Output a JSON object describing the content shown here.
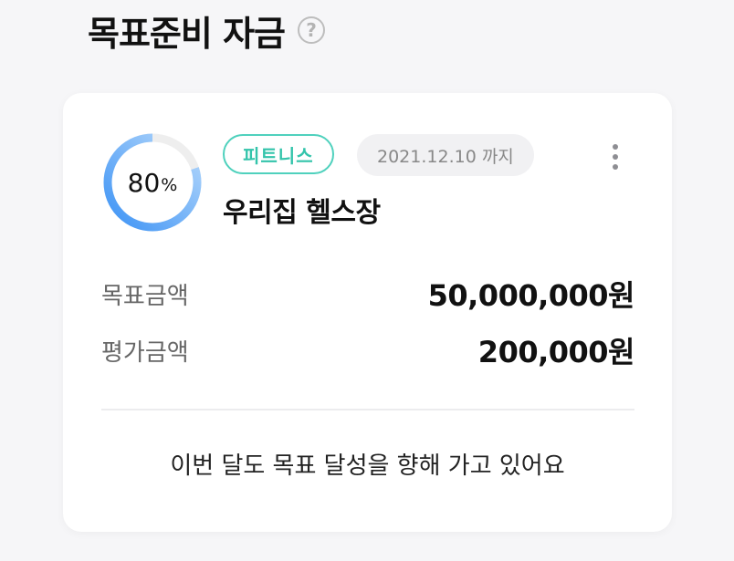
{
  "section": {
    "title": "목표준비 자금",
    "help_glyph": "?"
  },
  "goal_card": {
    "progress": {
      "value": "80",
      "unit": "%",
      "fraction": 0.8,
      "color_start": "#3d93f5",
      "color_end": "#b7d9fb",
      "track_color": "#eeeeee"
    },
    "category_tag": "피트니스",
    "due_date": "2021.12.10 까지",
    "goal_name": "우리집 헬스장",
    "more_icon": "more-vertical-icon",
    "rows": [
      {
        "label": "목표금액",
        "value": "50,000,000원"
      },
      {
        "label": "평가금액",
        "value": "200,000원"
      }
    ],
    "message": "이번 달도 목표 달성을 향해 가고 있어요"
  },
  "colors": {
    "tag_accent": "#33c4ab",
    "background": "#f6f6f8"
  }
}
